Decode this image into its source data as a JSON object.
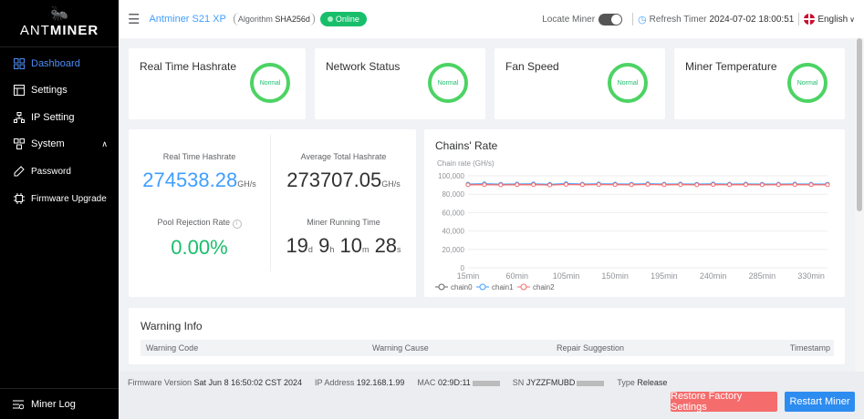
{
  "sidebar": {
    "logo": "ANTMINER",
    "logo_prefix": "ANT",
    "logo_suffix": "MINER",
    "items": [
      {
        "label": "Dashboard",
        "icon": "dashboard-icon",
        "active": true
      },
      {
        "label": "Settings",
        "icon": "settings-icon"
      },
      {
        "label": "IP Setting",
        "icon": "network-icon"
      },
      {
        "label": "System",
        "icon": "system-icon"
      },
      {
        "label": "Password",
        "icon": "lock-icon"
      },
      {
        "label": "Firmware Upgrade",
        "icon": "chip-icon"
      }
    ],
    "miner_log": "Miner Log"
  },
  "header": {
    "model": "Antminer S21 XP",
    "algorithm_label": "Algorithm",
    "algorithm": "SHA256d",
    "status": "Online",
    "locate_label": "Locate Miner",
    "refresh_label": "Refresh Timer",
    "refresh_time": "2024-07-02 18:00:51",
    "language": "English"
  },
  "stats": [
    {
      "title": "Real Time Hashrate",
      "status": "Normal"
    },
    {
      "title": "Network Status",
      "status": "Normal"
    },
    {
      "title": "Fan Speed",
      "status": "Normal"
    },
    {
      "title": "Miner Temperature",
      "status": "Normal"
    }
  ],
  "metrics": {
    "realtime_label": "Real Time Hashrate",
    "realtime_value": "274538.28",
    "realtime_unit": "GH/s",
    "avg_label": "Average Total Hashrate",
    "avg_value": "273707.05",
    "avg_unit": "GH/s",
    "rejection_label": "Pool Rejection Rate",
    "rejection_value": "0.00%",
    "runtime_label": "Miner Running Time",
    "runtime_days": "19",
    "runtime_hours": "9",
    "runtime_minutes": "10",
    "runtime_seconds": "28",
    "unit_d": "d",
    "unit_h": "h",
    "unit_m": "m",
    "unit_s": "s"
  },
  "chart_data": {
    "type": "line",
    "title": "Chains' Rate",
    "ylabel": "Chain rate (GH/s)",
    "ylim": [
      0,
      100000
    ],
    "yticks": [
      "100,000",
      "80,000",
      "60,000",
      "40,000",
      "20,000",
      "0"
    ],
    "x": [
      "15min",
      "30min",
      "45min",
      "60min",
      "75min",
      "90min",
      "105min",
      "120min",
      "135min",
      "150min",
      "165min",
      "180min",
      "195min",
      "210min",
      "225min",
      "240min",
      "255min",
      "270min",
      "285min",
      "300min",
      "315min",
      "330min",
      "345min"
    ],
    "xticks": [
      "15min",
      "60min",
      "105min",
      "150min",
      "195min",
      "240min",
      "285min",
      "330min"
    ],
    "series": [
      {
        "name": "chain0",
        "color": "#606266",
        "values": [
          90500,
          90800,
          90400,
          90600,
          90700,
          90300,
          91000,
          90600,
          90800,
          90700,
          90500,
          90900,
          90600,
          90700,
          90500,
          90800,
          90600,
          90700,
          90500,
          90600,
          90700,
          90600,
          90500
        ]
      },
      {
        "name": "chain1",
        "color": "#409eff",
        "values": [
          91000,
          91300,
          90800,
          91100,
          91200,
          90700,
          91400,
          91000,
          91200,
          91100,
          90900,
          91300,
          91000,
          91100,
          90900,
          91200,
          91000,
          91100,
          90900,
          91000,
          91100,
          91000,
          90900
        ]
      },
      {
        "name": "chain2",
        "color": "#f56c6c",
        "values": [
          90200,
          90400,
          90100,
          90300,
          90400,
          90000,
          90600,
          90300,
          90500,
          90400,
          90200,
          90600,
          90300,
          90400,
          90200,
          90500,
          90300,
          90400,
          90200,
          90300,
          90400,
          90300,
          90200
        ]
      }
    ],
    "legend_position": "bottom-left"
  },
  "warning": {
    "title": "Warning Info",
    "columns": [
      "Warning Code",
      "Warning Cause",
      "Repair Suggestion",
      "Timestamp"
    ]
  },
  "footer": {
    "firmware_label": "Firmware Version",
    "firmware": "Sat Jun 8 16:50:02 CST 2024",
    "ip_label": "IP Address",
    "ip": "192.168.1.99",
    "mac_label": "MAC",
    "mac": "02:9D:11",
    "sn_label": "SN",
    "sn": "JYZZFMUBD",
    "type_label": "Type",
    "type": "Release",
    "restore_button": "Restore Factory Settings",
    "restart_button": "Restart Miner"
  }
}
